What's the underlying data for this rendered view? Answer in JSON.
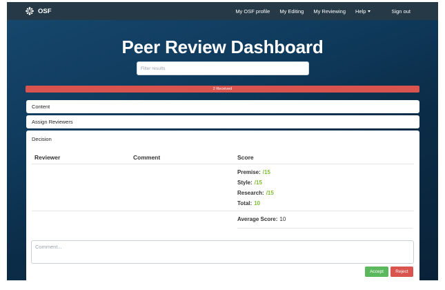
{
  "navbar": {
    "brand": "OSF",
    "brand_icon": "osf-logo-icon",
    "links": [
      "My OSF profile",
      "My Editing",
      "My Reviewing"
    ],
    "help_label": "Help",
    "help_icon": "caret-down-icon",
    "signout_label": "Sign out"
  },
  "header": {
    "title": "Peer Review Dashboard",
    "filter_placeholder": "Filter results"
  },
  "status_bar": {
    "text": "2 Received",
    "color": "#d9534f"
  },
  "panels": {
    "content": "Content",
    "assign_reviewers": "Assign Reviewers",
    "decision": "Decision"
  },
  "decision_table": {
    "headers": {
      "reviewer": "Reviewer",
      "comment": "Comment",
      "score": "Score"
    },
    "scores": [
      {
        "label": "Premise:",
        "value": "/15"
      },
      {
        "label": "Style:",
        "value": "/15"
      },
      {
        "label": "Research:",
        "value": "/15"
      },
      {
        "label": "Total:",
        "value": "10"
      }
    ],
    "average_label": "Average Score:",
    "average_value": "10"
  },
  "comment_placeholder": "Comment...",
  "actions": {
    "accept": "Accept",
    "reject": "Reject"
  },
  "colors": {
    "navbar": "#263947",
    "accent_green": "#7cbf32",
    "accept": "#5cb85c",
    "reject": "#d9534f",
    "background": "#0f3a5c"
  }
}
